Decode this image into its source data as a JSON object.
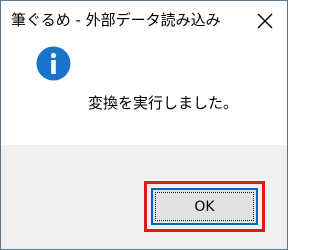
{
  "window": {
    "title": "筆ぐるめ - 外部データ読み込み",
    "close_icon": "close-icon"
  },
  "content": {
    "icon": "info-icon",
    "message": "変換を実行しました。"
  },
  "footer": {
    "ok_label": "OK"
  },
  "colors": {
    "info_icon_fill": "#1a73c9",
    "footer_bg": "#f0f0f0",
    "highlight": "#e01a1a",
    "button_focus_border": "#0067c0"
  }
}
